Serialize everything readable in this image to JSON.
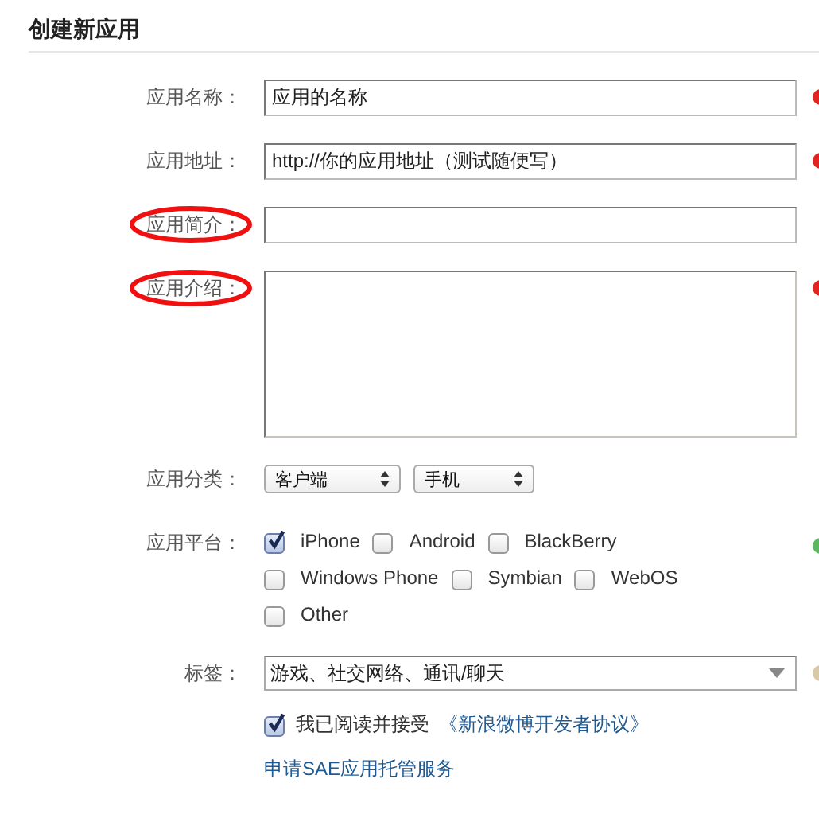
{
  "title": "创建新应用",
  "fields": [
    {
      "kind": "text",
      "label": "应用名称：",
      "value": "应用的名称",
      "circled": false,
      "color": "#e3241f"
    },
    {
      "kind": "text",
      "label": "应用地址：",
      "value": "http://你的应用地址（测试随便写）",
      "circled": false,
      "color": "#e3241f"
    },
    {
      "kind": "text",
      "label": "应用简介：",
      "circled": true
    },
    {
      "kind": "textarea",
      "label": "应用介绍：",
      "circled": true,
      "color": "#e3241f"
    },
    {
      "kind": "selects",
      "label": "应用分类：",
      "options": [
        "客户端",
        "手机"
      ]
    },
    {
      "kind": "checkboxes",
      "label": "应用平台：",
      "color": "#5cb85c",
      "rows": [
        [
          {
            "label": "iPhone",
            "checked": true
          },
          {
            "label": "Android",
            "checked": false
          },
          {
            "label": "BlackBerry",
            "checked": false
          }
        ],
        [
          {
            "label": "Windows Phone",
            "checked": false
          },
          {
            "label": "Symbian",
            "checked": false
          },
          {
            "label": "WebOS",
            "checked": false
          }
        ],
        [
          {
            "label": "Other",
            "checked": false
          }
        ]
      ]
    },
    {
      "kind": "combo",
      "label": "标签：",
      "value": "游戏、社交网络、通讯/聊天",
      "color": "#d9c9a6"
    },
    {
      "kind": "agree",
      "checked": true,
      "text": "我已阅读并接受",
      "link": "《新浪微博开发者协议》"
    },
    {
      "kind": "link",
      "text": "申请SAE应用托管服务"
    }
  ]
}
